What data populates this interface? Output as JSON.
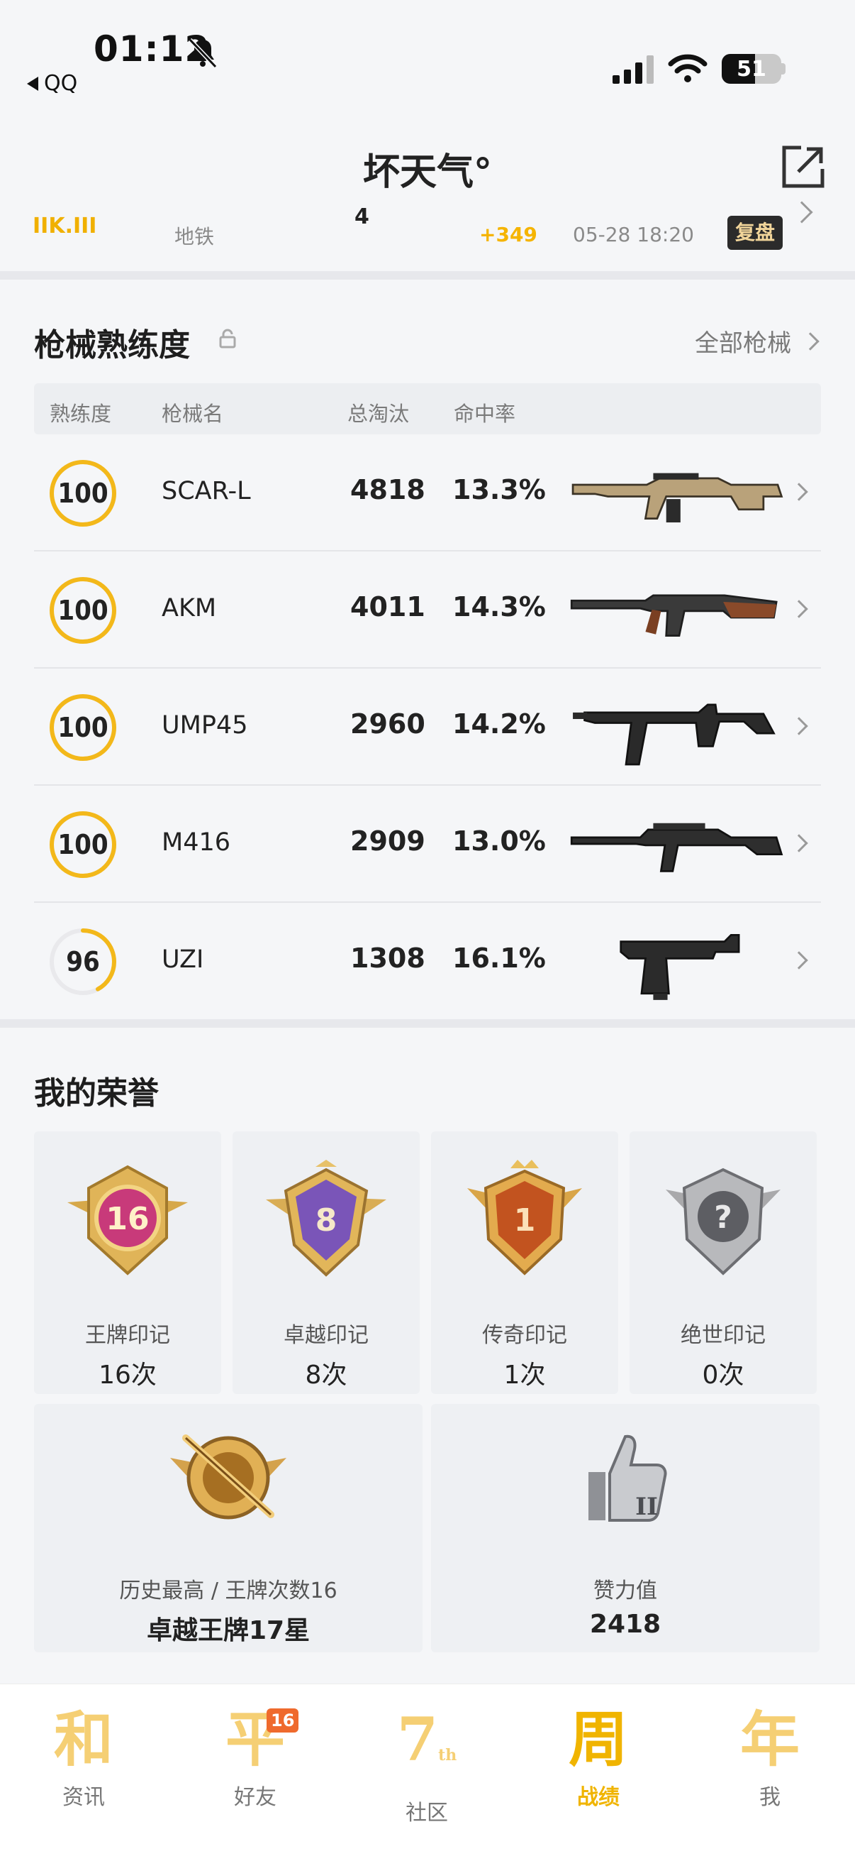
{
  "status_bar": {
    "time": "01:12",
    "back_app": "QQ",
    "battery": "51"
  },
  "header": {
    "title": "坏天气°"
  },
  "peek_row": {
    "logo_text": "IIK.III",
    "mode": "地铁",
    "number": "4",
    "score": "+349",
    "time": "05-28 18:20",
    "replay": "复盘"
  },
  "weapons": {
    "title": "枪械熟练度",
    "all_label": "全部枪械",
    "columns": [
      "熟练度",
      "枪械名",
      "总淘汰",
      "命中率"
    ],
    "rows": [
      {
        "level": "100",
        "progress": 1.0,
        "name": "SCAR-L",
        "kills": "4818",
        "accuracy": "13.3%",
        "icon": "scar-l-rifle-icon"
      },
      {
        "level": "100",
        "progress": 1.0,
        "name": "AKM",
        "kills": "4011",
        "accuracy": "14.3%",
        "icon": "akm-rifle-icon"
      },
      {
        "level": "100",
        "progress": 1.0,
        "name": "UMP45",
        "kills": "2960",
        "accuracy": "14.2%",
        "icon": "ump45-smg-icon"
      },
      {
        "level": "100",
        "progress": 1.0,
        "name": "M416",
        "kills": "2909",
        "accuracy": "13.0%",
        "icon": "m416-rifle-icon"
      },
      {
        "level": "96",
        "progress": 0.42,
        "name": "UZI",
        "kills": "1308",
        "accuracy": "16.1%",
        "icon": "uzi-smg-icon"
      }
    ]
  },
  "honors": {
    "title": "我的荣誉",
    "marks": [
      {
        "name": "王牌印记",
        "count": "16次",
        "badge_text": "16",
        "icon": "ace-mark-badge-icon"
      },
      {
        "name": "卓越印记",
        "count": "8次",
        "badge_text": "8",
        "icon": "excellent-mark-badge-icon"
      },
      {
        "name": "传奇印记",
        "count": "1次",
        "badge_text": "1",
        "icon": "legend-mark-badge-icon"
      },
      {
        "name": "绝世印记",
        "count": "0次",
        "badge_text": "?",
        "icon": "peerless-mark-badge-icon"
      }
    ],
    "best": {
      "label": "历史最高 / 王牌次数16",
      "value": "卓越王牌17星",
      "icon": "rank-emblem-icon"
    },
    "likes": {
      "label": "赞力值",
      "value": "2418",
      "icon": "thumbs-up-icon"
    }
  },
  "nav": {
    "items": [
      {
        "glyph": "和",
        "label": "资讯"
      },
      {
        "glyph": "平",
        "label": "好友",
        "badge": "16"
      },
      {
        "glyph": "7",
        "label": "社区",
        "sup": "th"
      },
      {
        "glyph": "周",
        "label": "战绩",
        "active": true
      },
      {
        "glyph": "年",
        "label": "我"
      }
    ]
  },
  "colors": {
    "accent": "#f5b400",
    "ring": "#f3b81a",
    "nav_glyph": "#f5cf74",
    "badge": "#ef6a2d"
  }
}
